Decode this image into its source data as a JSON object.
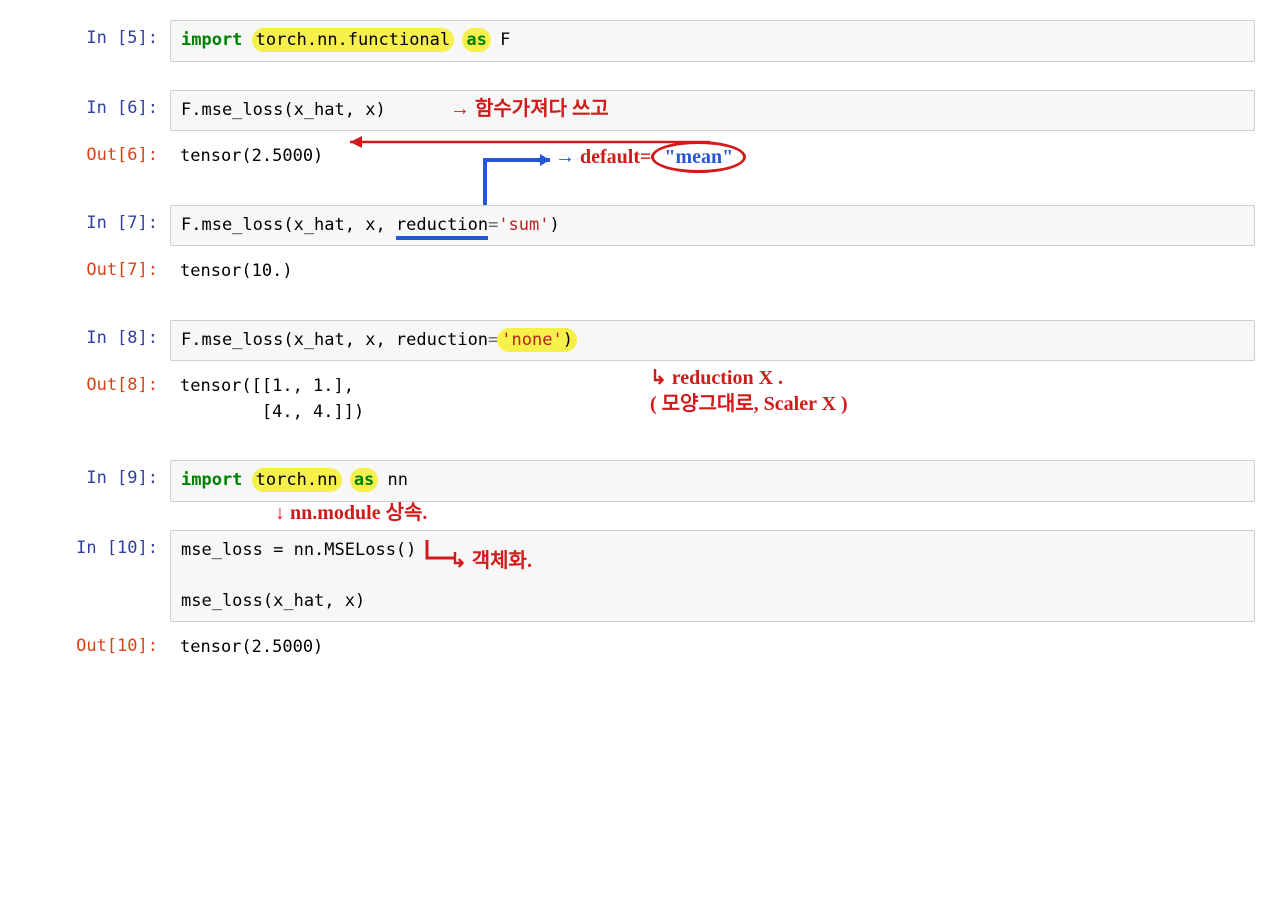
{
  "cells": {
    "c5": {
      "prompt": "In [5]:",
      "kw_import": "import",
      "module": "torch.nn.functional",
      "kw_as": "as",
      "alias": "F"
    },
    "c6": {
      "prompt": "In [6]:",
      "code": "F.mse_loss(x_hat, x)",
      "out_prompt": "Out[6]:",
      "out": "tensor(2.5000)"
    },
    "c7": {
      "prompt": "In [7]:",
      "pre": "F.mse_loss(x_hat, x, ",
      "kwarg": "reduction",
      "eq": "=",
      "val": "'sum'",
      "post": ")",
      "out_prompt": "Out[7]:",
      "out": "tensor(10.)"
    },
    "c8": {
      "prompt": "In [8]:",
      "pre": "F.mse_loss(x_hat, x, reduction",
      "eq": "=",
      "val": "'none'",
      "post": ")",
      "out_prompt": "Out[8]:",
      "out": "tensor([[1., 1.],\n        [4., 4.]])"
    },
    "c9": {
      "prompt": "In [9]:",
      "kw_import": "import",
      "module": "torch.nn",
      "kw_as": "as",
      "alias": "nn"
    },
    "c10": {
      "prompt": "In [10]:",
      "line1": "mse_loss = nn.MSELoss()",
      "line2": "mse_loss(x_hat, x)",
      "out_prompt": "Out[10]:",
      "out": "tensor(2.5000)"
    }
  },
  "annotations": {
    "a1": "→ 함수가져다 쓰고",
    "a2_pre": "default=",
    "a2_val": "\"mean\"",
    "a3a": "↳ reduction X .",
    "a3b": "( 모양그대로, Scaler X )",
    "a4": "↓ nn.module 상속.",
    "a5": "↳ 객체화."
  }
}
